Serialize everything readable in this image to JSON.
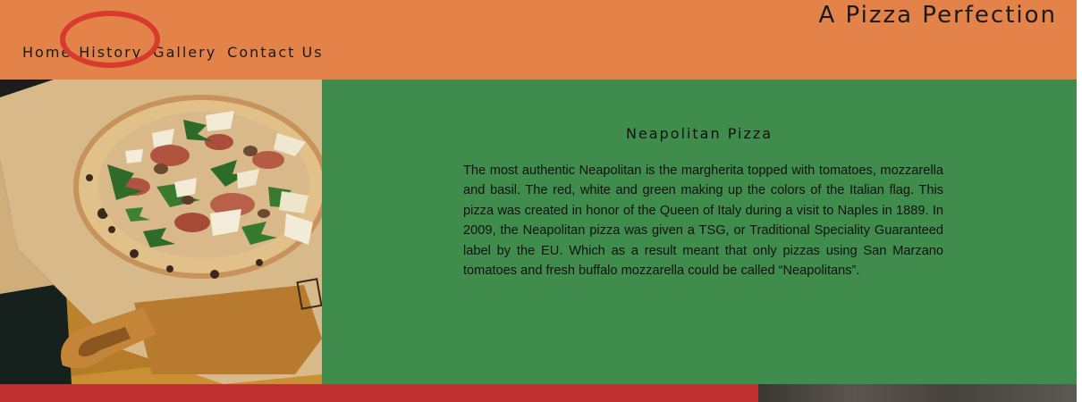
{
  "header": {
    "title": "A Pizza Perfection",
    "nav": [
      {
        "label": "Home"
      },
      {
        "label": "History"
      },
      {
        "label": "Gallery"
      },
      {
        "label": "Contact Us"
      }
    ]
  },
  "main": {
    "heading": "Neapolitan Pizza",
    "body": "The most authentic Neapolitan is the margherita topped with tomatoes, mozzarella and basil. The red, white and green making up the colors of the Italian flag. This pizza was created in honor of the Queen of Italy during a visit to Naples in 1889. In 2009, the Neapolitan pizza was given a TSG, or Traditional Speciality Guaranteed label by the EU. Which as a result meant that only pizzas using San Marzano tomatoes and fresh buffalo mozzarella could be called “Neapolitans”."
  },
  "colors": {
    "header_bg": "#e3834a",
    "panel_bg": "#3f8c4d",
    "footer_red": "#bf2f30",
    "annotation": "#d83a2c"
  }
}
